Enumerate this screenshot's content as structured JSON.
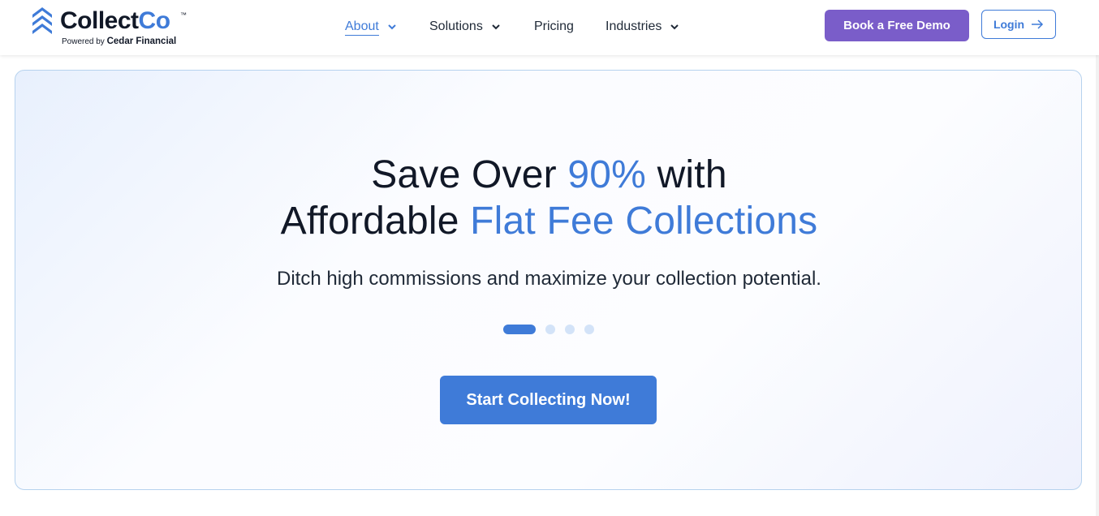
{
  "brand": {
    "name_main": "Collect",
    "name_accent": "Co",
    "trademark": "™",
    "powered_prefix": "Powered by",
    "powered_company": "Cedar Financial",
    "colors": {
      "primary": "#3f7bd8",
      "purple": "#7a5dc9",
      "dark": "#111827"
    },
    "logo_icon": "stacked-chevrons-icon"
  },
  "nav": {
    "items": [
      {
        "label": "About",
        "has_dropdown": true,
        "active": true
      },
      {
        "label": "Solutions",
        "has_dropdown": true,
        "active": false
      },
      {
        "label": "Pricing",
        "has_dropdown": false,
        "active": false
      },
      {
        "label": "Industries",
        "has_dropdown": true,
        "active": false
      }
    ],
    "demo_label": "Book a Free Demo",
    "login_label": "Login",
    "login_icon": "arrow-right-icon"
  },
  "hero": {
    "line1_pre": "Save Over ",
    "line1_accent": "90%",
    "line1_post": " with",
    "line2_pre": "Affordable ",
    "line2_accent": "Flat Fee Collections",
    "subhead": "Ditch high commissions and maximize your collection potential.",
    "carousel": {
      "count": 4,
      "active_index": 0
    },
    "cta_label": "Start Collecting Now!"
  }
}
